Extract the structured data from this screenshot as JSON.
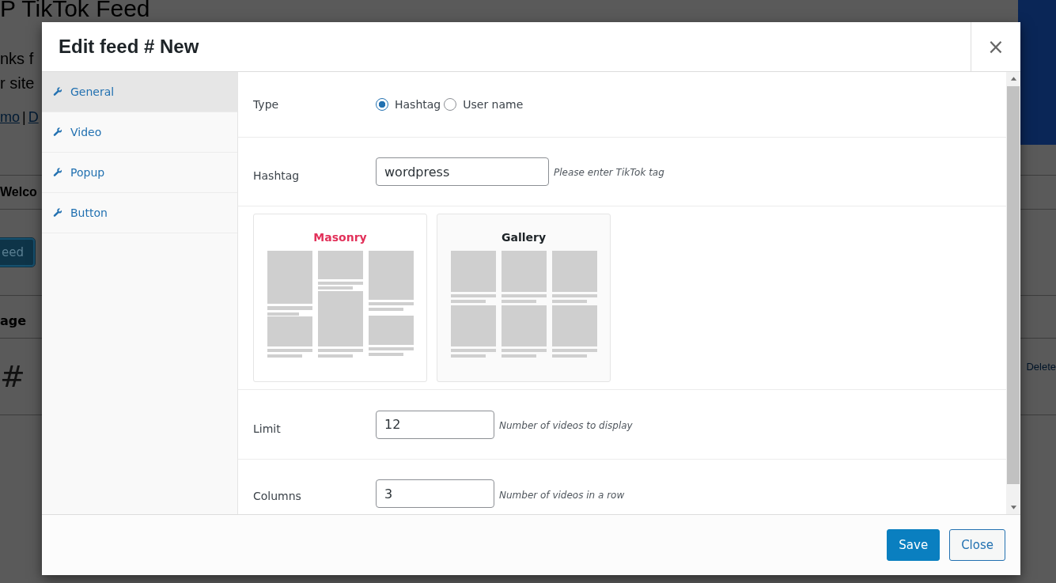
{
  "background": {
    "title": "P TikTok Feed",
    "intro_lines": [
      "nks f",
      "r site"
    ],
    "links": [
      "mo",
      "D"
    ],
    "link_separator": "|",
    "section_heading": "Welco",
    "button": "eed",
    "table_header": "age",
    "row_cell": "#",
    "row_action": "Delete"
  },
  "modal": {
    "title": "Edit feed # New",
    "close": "×",
    "tabs": [
      {
        "label": "General",
        "selected": true
      },
      {
        "label": "Video",
        "selected": false
      },
      {
        "label": "Popup",
        "selected": false
      },
      {
        "label": "Button",
        "selected": false
      }
    ],
    "fields": [
      {
        "kind": "radio",
        "label": "Type",
        "options": [
          {
            "label": "Hashtag",
            "selected": true
          },
          {
            "label": "User name",
            "selected": false
          }
        ]
      },
      {
        "kind": "text",
        "label": "Hashtag",
        "value": "wordpress",
        "hint": "Please enter TikTok tag"
      },
      {
        "kind": "layouts",
        "options": [
          {
            "label": "Masonry",
            "kind": "masonry",
            "selected": true
          },
          {
            "label": "Gallery",
            "kind": "gallery",
            "selected": false
          }
        ]
      },
      {
        "kind": "number",
        "label": "Limit",
        "value": "12",
        "hint": "Number of videos to display"
      },
      {
        "kind": "number",
        "label": "Columns",
        "value": "3",
        "hint": "Number of videos in a row"
      }
    ],
    "buttons": [
      {
        "label": "Save",
        "kind": "primary"
      },
      {
        "label": "Close",
        "kind": "secondary"
      }
    ]
  }
}
